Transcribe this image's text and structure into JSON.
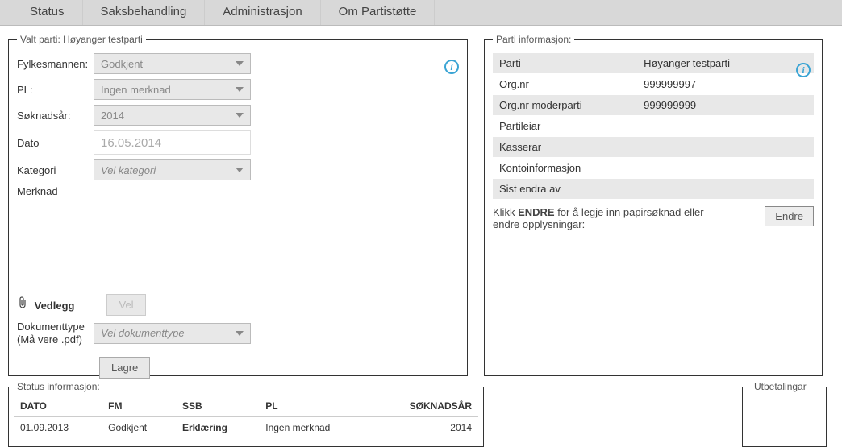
{
  "nav": {
    "status": "Status",
    "saks": "Saksbehandling",
    "admin": "Administrasjon",
    "om": "Om Partistøtte"
  },
  "valtparti": {
    "legend": "Valt parti: Høyanger testparti",
    "fields": {
      "fylkesmannen_label": "Fylkesmannen:",
      "fylkesmannen_value": "Godkjent",
      "pl_label": "PL:",
      "pl_value": "Ingen merknad",
      "soknadsar_label": "Søknadsår:",
      "soknadsar_value": "2014",
      "dato_label": "Dato",
      "dato_value": "16.05.2014",
      "kategori_label": "Kategori",
      "kategori_value": "Vel kategori",
      "merknad_label": "Merknad"
    },
    "vedlegg": {
      "title": "Vedlegg",
      "vel_btn": "Vel",
      "doktype_label1": "Dokumenttype",
      "doktype_label2": "(Må vere .pdf)",
      "doktype_value": "Vel dokumenttype",
      "lagre_btn": "Lagre"
    }
  },
  "partiinfo": {
    "legend": "Parti informasjon:",
    "rows": [
      {
        "label": "Parti",
        "value": "Høyanger testparti"
      },
      {
        "label": "Org.nr",
        "value": "999999997"
      },
      {
        "label": "Org.nr moderparti",
        "value": "999999999"
      },
      {
        "label": "Partileiar",
        "value": ""
      },
      {
        "label": "Kasserar",
        "value": ""
      },
      {
        "label": "Kontoinformasjon",
        "value": ""
      },
      {
        "label": "Sist endra av",
        "value": ""
      }
    ],
    "endre_text1": "Klikk ",
    "endre_bold": "ENDRE",
    "endre_text2": " for å legje inn papirsøknad eller endre opplysningar:",
    "endre_btn": "Endre"
  },
  "statusinfo": {
    "legend": "Status informasjon:",
    "headers": {
      "dato": "DATO",
      "fm": "FM",
      "ssb": "SSB",
      "pl": "PL",
      "soknadsar": "SØKNADSÅR"
    },
    "row": {
      "dato": "01.09.2013",
      "fm": "Godkjent",
      "ssb": "Erklæring",
      "pl": "Ingen merknad",
      "soknadsar": "2014"
    }
  },
  "utbetalingar": {
    "legend": "Utbetalingar"
  }
}
